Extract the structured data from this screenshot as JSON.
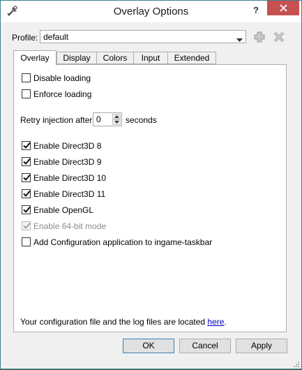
{
  "window": {
    "title": "Overlay Options",
    "help_label": "?"
  },
  "profile": {
    "label": "Profile:",
    "value": "default"
  },
  "tabs": [
    {
      "label": "Overlay",
      "active": true
    },
    {
      "label": "Display"
    },
    {
      "label": "Colors"
    },
    {
      "label": "Input"
    },
    {
      "label": "Extended"
    }
  ],
  "overlay": {
    "disable_loading": {
      "label": "Disable loading",
      "checked": false
    },
    "enforce_loading": {
      "label": "Enforce loading",
      "checked": false
    },
    "retry": {
      "label": "Retry injection after",
      "value": "0",
      "unit": "seconds"
    },
    "d3d8": {
      "label": "Enable Direct3D 8",
      "checked": true
    },
    "d3d9": {
      "label": "Enable Direct3D 9",
      "checked": true
    },
    "d3d10": {
      "label": "Enable Direct3D 10",
      "checked": true
    },
    "d3d11": {
      "label": "Enable Direct3D 11",
      "checked": true
    },
    "opengl": {
      "label": "Enable OpenGL",
      "checked": true
    },
    "x64": {
      "label": "Enable 64-bit mode",
      "checked": true,
      "disabled": true
    },
    "taskbar": {
      "label": "Add Configuration application to ingame-taskbar",
      "checked": false
    },
    "note_prefix": "Your configuration file and the log files are located ",
    "note_link": "here",
    "note_suffix": "."
  },
  "buttons": {
    "ok": "OK",
    "cancel": "Cancel",
    "apply": "Apply"
  }
}
